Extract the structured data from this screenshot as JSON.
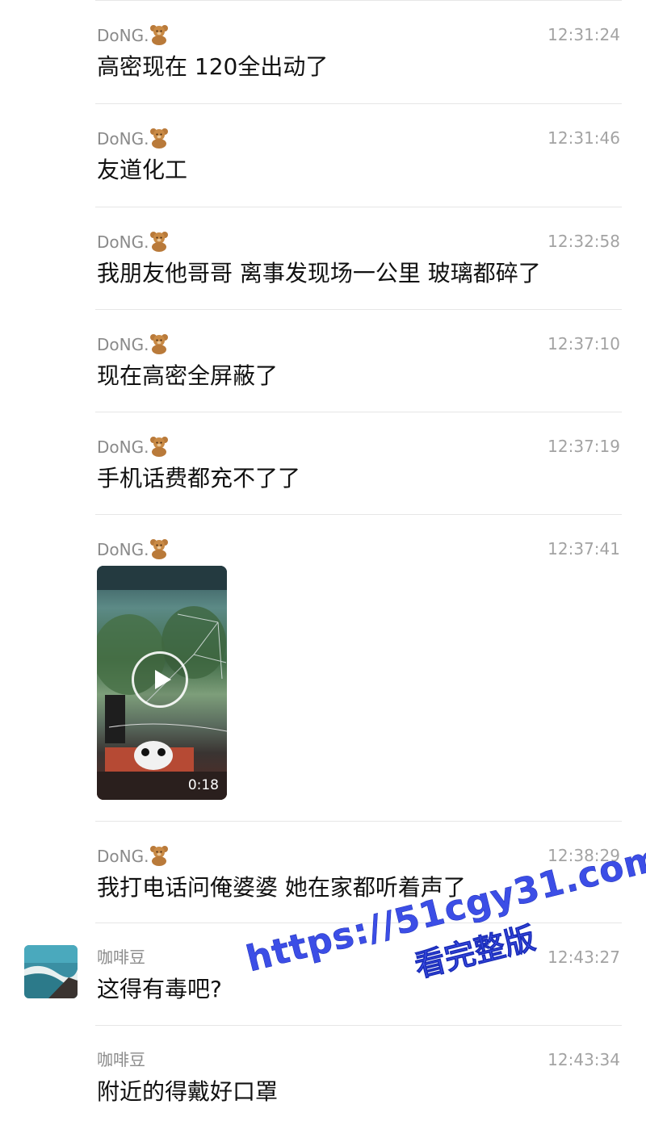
{
  "messages": [
    {
      "sender": "DoNG.",
      "time": "12:31:24",
      "text": "高密现在 120全出动了"
    },
    {
      "sender": "DoNG.",
      "time": "12:31:46",
      "text": "友道化工"
    },
    {
      "sender": "DoNG.",
      "time": "12:32:58",
      "text": "我朋友他哥哥 离事发现场一公里 玻璃都碎了"
    },
    {
      "sender": "DoNG.",
      "time": "12:37:10",
      "text": "现在高密全屏蔽了"
    },
    {
      "sender": "DoNG.",
      "time": "12:37:19",
      "text": "手机话费都充不了了"
    },
    {
      "sender": "DoNG.",
      "time": "12:37:41",
      "video_duration": "0:18"
    },
    {
      "sender": "DoNG.",
      "time": "12:38:29",
      "text": "我打电话问俺婆婆 她在家都听着声了"
    },
    {
      "sender": "咖啡豆",
      "time": "12:43:27",
      "text": "这得有毒吧?"
    },
    {
      "sender": "咖啡豆",
      "time": "12:43:34",
      "text": "附近的得戴好口罩"
    }
  ],
  "watermark": {
    "line1": "https://51cgy31.com",
    "line2": "看完整版"
  },
  "colors": {
    "watermark": "#3c4ee6",
    "sender": "#8a8a8a",
    "time": "#a3a3a3",
    "separator": "#e6e6e6"
  }
}
